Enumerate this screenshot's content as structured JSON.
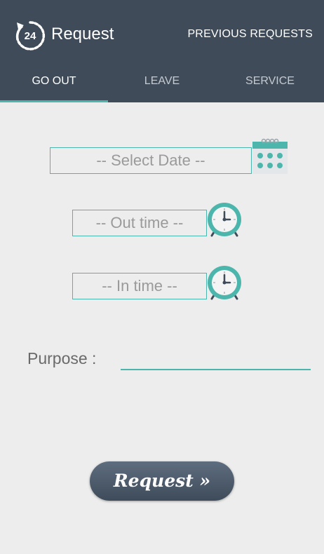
{
  "appbar": {
    "logo_text": "24",
    "title": "Request",
    "action": "PREVIOUS REQUESTS"
  },
  "tabs": [
    {
      "label": "GO OUT",
      "active": true
    },
    {
      "label": "LEAVE",
      "active": false
    },
    {
      "label": "SERVICE",
      "active": false
    }
  ],
  "form": {
    "date_placeholder": "-- Select Date --",
    "out_time_placeholder": "-- Out time --",
    "in_time_placeholder": "-- In time --",
    "purpose_label": "Purpose :",
    "purpose_value": ""
  },
  "submit": {
    "label": "Request  »"
  },
  "colors": {
    "appbar": "#3f4b59",
    "accent": "#4db6ac",
    "background": "#ededed"
  },
  "icons": [
    "clock-24-logo-icon",
    "calendar-icon",
    "alarm-clock-icon"
  ]
}
